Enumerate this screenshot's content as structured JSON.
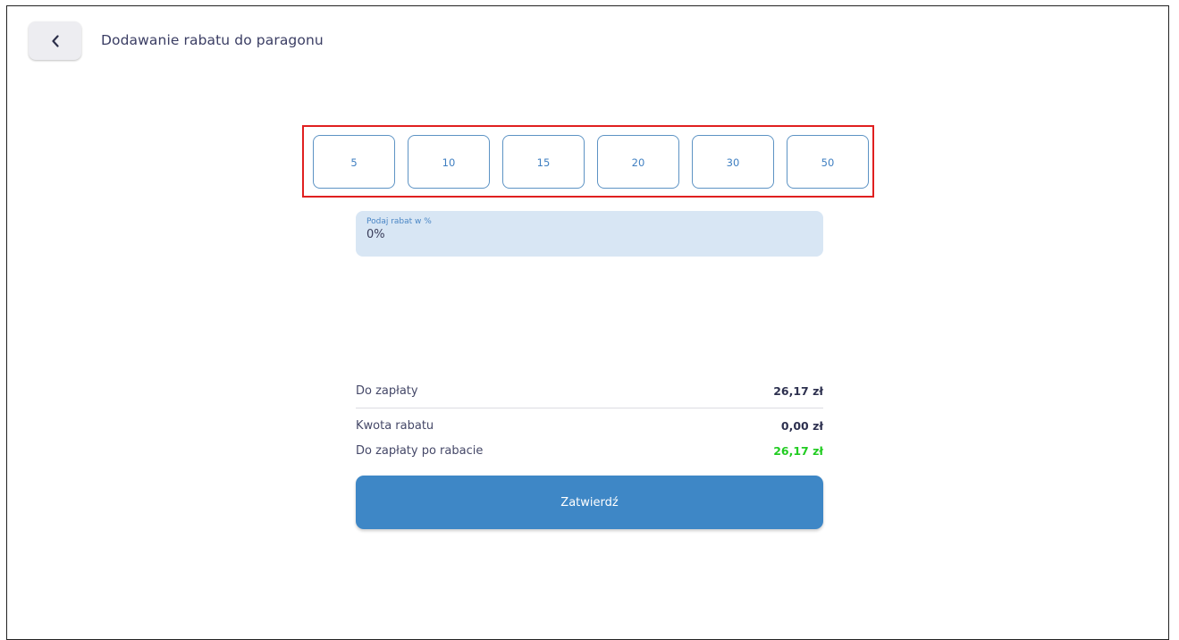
{
  "header": {
    "back_icon": "chevron-left-icon",
    "title": "Dodawanie rabatu do paragonu"
  },
  "presets": [
    "5",
    "10",
    "15",
    "20",
    "30",
    "50"
  ],
  "discount_input": {
    "label": "Podaj rabat w %",
    "value": "0%"
  },
  "summary": {
    "to_pay_label": "Do zapłaty",
    "to_pay_value": "26,17 zł",
    "discount_label": "Kwota rabatu",
    "discount_value": "0,00 zł",
    "after_discount_label": "Do zapłaty po rabacie",
    "after_discount_value": "26,17 zł"
  },
  "confirm_label": "Zatwierdź",
  "colors": {
    "accent": "#3e87c6",
    "input_bg": "#d8e6f4",
    "highlight": "#e02020",
    "success": "#22cc22"
  }
}
